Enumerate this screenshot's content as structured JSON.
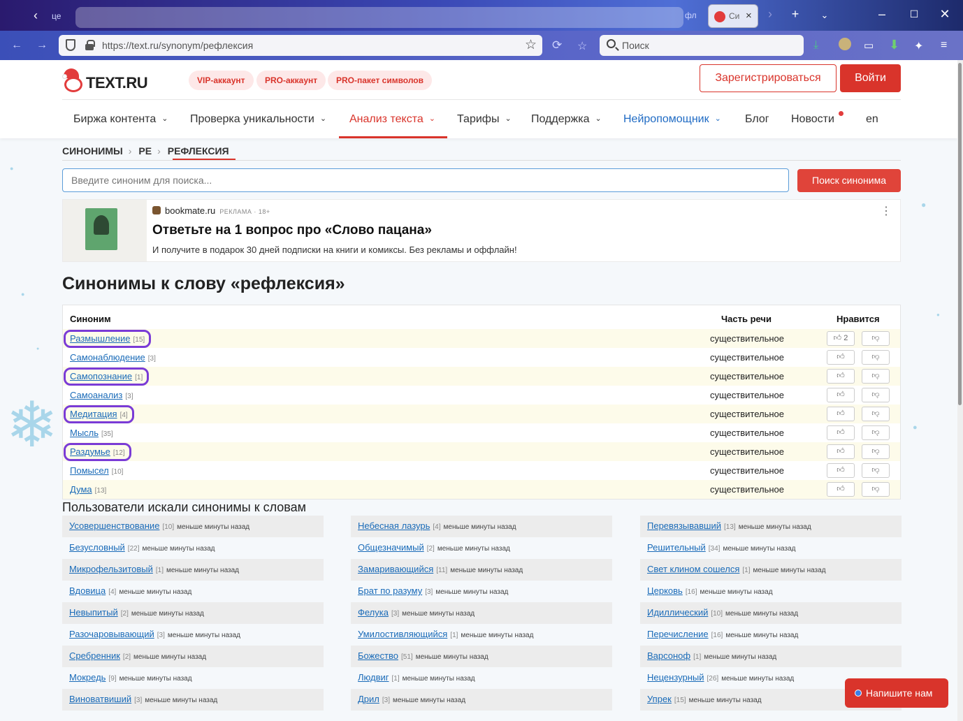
{
  "browser": {
    "tab_left_fragment": "це",
    "tab_right_fragment": "фл",
    "active_tab_title": "Си",
    "url": "https://text.ru/synonym/рефлексия",
    "search_placeholder": "Поиск"
  },
  "header": {
    "logo_text": "TEXT.RU",
    "pills": [
      "VIP-аккаунт",
      "PRO-аккаунт",
      "PRO-пакет символов"
    ],
    "register_label": "Зарегистрироваться",
    "login_label": "Войти"
  },
  "menu": [
    {
      "label": "Биржа контента",
      "has_chevron": true
    },
    {
      "label": "Проверка уникальности",
      "has_chevron": true
    },
    {
      "label": "Анализ текста",
      "has_chevron": true,
      "active": true
    },
    {
      "label": "Тарифы",
      "has_chevron": true
    },
    {
      "label": "Поддержка",
      "has_chevron": true
    },
    {
      "label": "Нейропомощник",
      "has_chevron": true
    },
    {
      "label": "Блог",
      "has_chevron": false
    },
    {
      "label": "Новости",
      "has_chevron": false
    },
    {
      "label": "en",
      "has_chevron": false
    }
  ],
  "breadcrumb": [
    "СИНОНИМЫ",
    "РЕ",
    "РЕФЛЕКСИЯ"
  ],
  "search": {
    "placeholder": "Введите синоним для поиска...",
    "button_label": "Поиск синонима"
  },
  "ad": {
    "source": "bookmate.ru",
    "label": "РЕКЛАМА · 18+",
    "headline": "Ответьте на 1 вопрос про «Слово пацана»",
    "description": "И получите в подарок 30 дней подписки на книги и комиксы. Без рекламы и оффлайн!"
  },
  "page_title": "Синонимы к слову «рефлексия»",
  "table": {
    "col_synonym": "Синоним",
    "col_pos": "Часть речи",
    "col_like": "Нравится",
    "rows": [
      {
        "word": "Размышление",
        "count": "[15]",
        "pos": "существительное",
        "likes": "2",
        "highlighted": true
      },
      {
        "word": "Самонаблюдение",
        "count": "[3]",
        "pos": "существительное",
        "likes": "",
        "highlighted": false
      },
      {
        "word": "Самопознание",
        "count": "[1]",
        "pos": "существительное",
        "likes": "",
        "highlighted": true
      },
      {
        "word": "Самоанализ",
        "count": "[3]",
        "pos": "существительное",
        "likes": "",
        "highlighted": false
      },
      {
        "word": "Медитация",
        "count": "[4]",
        "pos": "существительное",
        "likes": "",
        "highlighted": true
      },
      {
        "word": "Мысль",
        "count": "[35]",
        "pos": "существительное",
        "likes": "",
        "highlighted": false
      },
      {
        "word": "Раздумье",
        "count": "[12]",
        "pos": "существительное",
        "likes": "",
        "highlighted": true
      },
      {
        "word": "Помысел",
        "count": "[10]",
        "pos": "существительное",
        "likes": "",
        "highlighted": false
      },
      {
        "word": "Дума",
        "count": "[13]",
        "pos": "существительное",
        "likes": "",
        "highlighted": false
      }
    ]
  },
  "users": {
    "title": "Пользователи искали синонимы к словам",
    "ago": "меньше минуты назад",
    "columns": [
      [
        {
          "word": "Усовершенствование",
          "count": "[10]"
        },
        {
          "word": "Безусловный",
          "count": "[22]"
        },
        {
          "word": "Микрофельзитовый",
          "count": "[1]"
        },
        {
          "word": "Вдовица",
          "count": "[4]"
        },
        {
          "word": "Невыпитый",
          "count": "[2]"
        },
        {
          "word": "Разочаровывающий",
          "count": "[3]"
        },
        {
          "word": "Сребренник",
          "count": "[2]"
        },
        {
          "word": "Мокредь",
          "count": "[9]"
        },
        {
          "word": "Виноватвиший",
          "count": "[3]"
        }
      ],
      [
        {
          "word": "Небесная лазурь",
          "count": "[4]"
        },
        {
          "word": "Общезначимый",
          "count": "[2]"
        },
        {
          "word": "Замаривающийся",
          "count": "[11]"
        },
        {
          "word": "Брат по разуму",
          "count": "[3]"
        },
        {
          "word": "Фелука",
          "count": "[3]"
        },
        {
          "word": "Умилостивляющийся",
          "count": "[1]"
        },
        {
          "word": "Божество",
          "count": "[51]"
        },
        {
          "word": "Людвиг",
          "count": "[1]"
        },
        {
          "word": "Дрил",
          "count": "[3]"
        }
      ],
      [
        {
          "word": "Перевязывавший",
          "count": "[13]"
        },
        {
          "word": "Решительный",
          "count": "[34]"
        },
        {
          "word": "Свет клином сошелся",
          "count": "[1]"
        },
        {
          "word": "Церковь",
          "count": "[16]"
        },
        {
          "word": "Идиллический",
          "count": "[10]"
        },
        {
          "word": "Перечисление",
          "count": "[16]"
        },
        {
          "word": "Варсоноф",
          "count": "[1]"
        },
        {
          "word": "Нецензурный",
          "count": "[26]"
        },
        {
          "word": "Упрек",
          "count": "[15]"
        }
      ]
    ]
  },
  "chat_label": "Напишите нам",
  "colors": {
    "brand_red": "#d9342b",
    "link_blue": "#1a6bb8",
    "highlight_purple": "#7a3bd6"
  }
}
